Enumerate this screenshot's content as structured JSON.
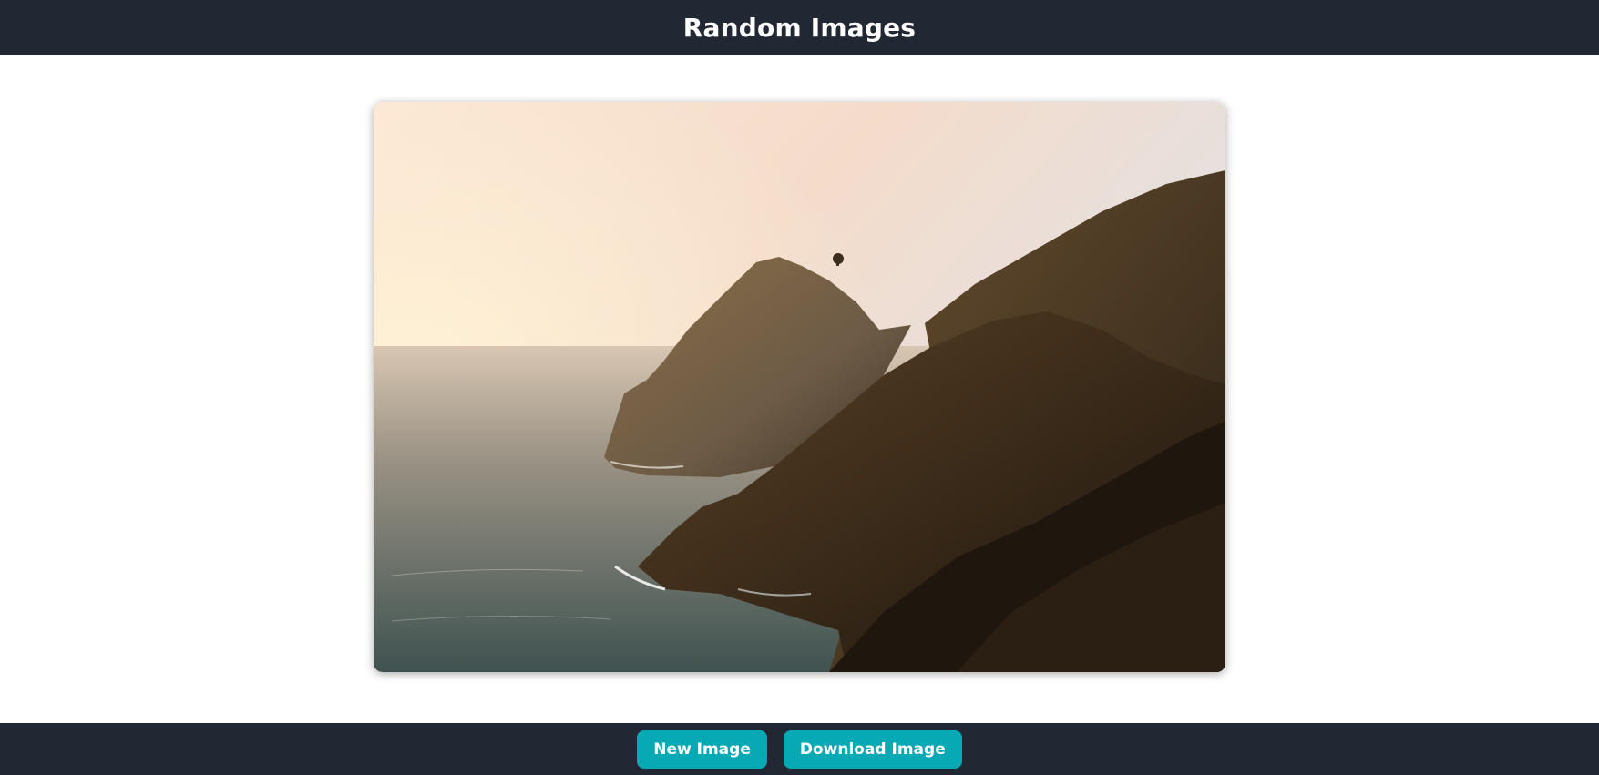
{
  "header": {
    "title": "Random Images"
  },
  "image": {
    "subject": "coastal cliffs at sunset over the ocean"
  },
  "footer": {
    "new_image_label": "New Image",
    "download_image_label": "Download Image"
  },
  "colors": {
    "bar_background": "#212733",
    "button_background": "#07a9b5",
    "button_text": "#ffffff",
    "page_background": "#ffffff"
  }
}
